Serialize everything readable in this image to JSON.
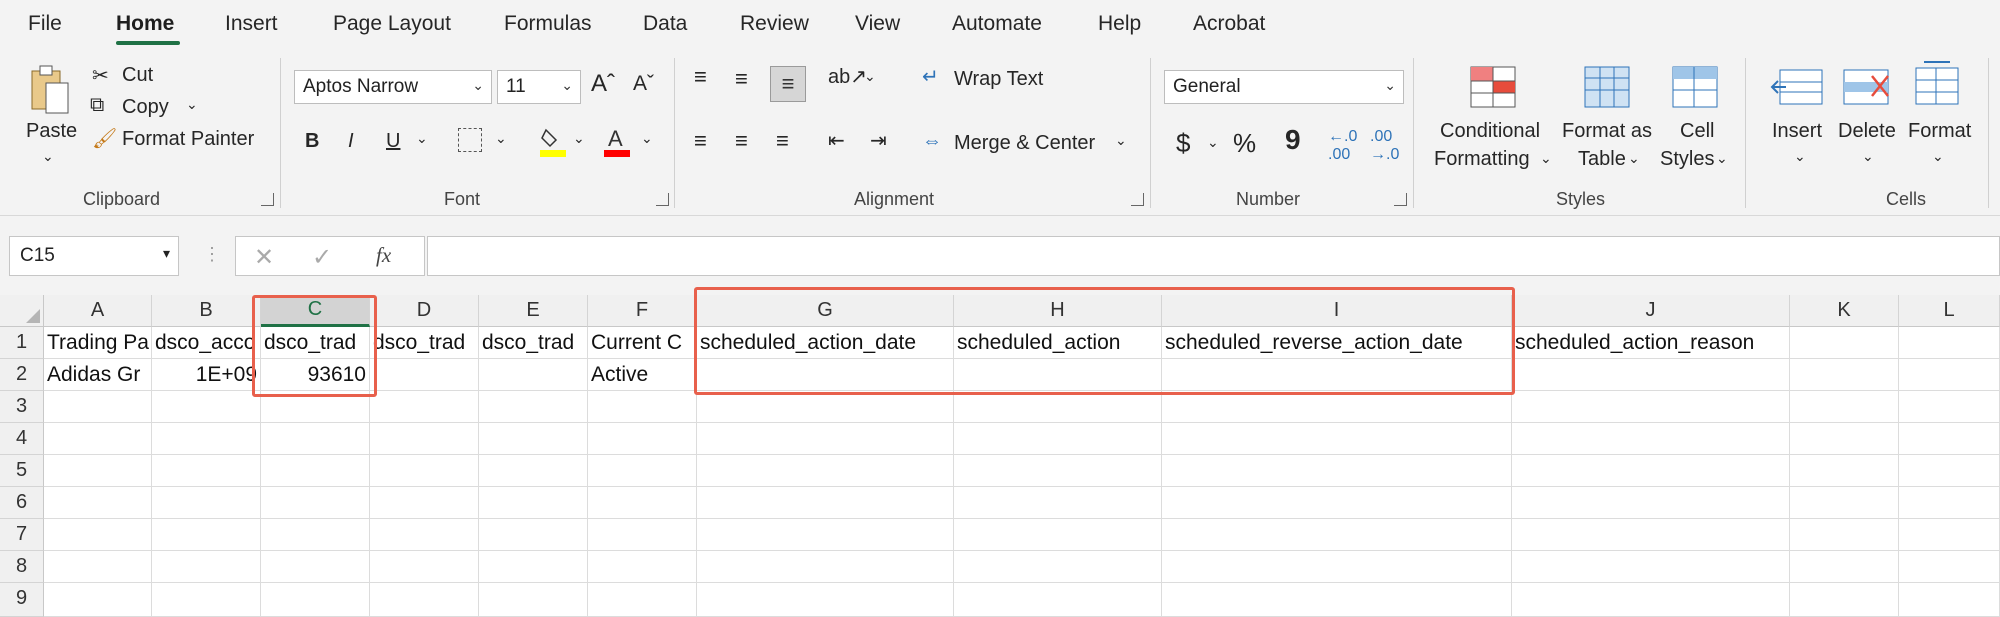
{
  "menu": {
    "items": [
      "File",
      "Home",
      "Insert",
      "Page Layout",
      "Formulas",
      "Data",
      "Review",
      "View",
      "Automate",
      "Help",
      "Acrobat"
    ],
    "active": "Home"
  },
  "ribbon": {
    "clipboard": {
      "paste": "Paste",
      "cut": "Cut",
      "copy": "Copy",
      "format_painter": "Format Painter",
      "label": "Clipboard"
    },
    "font": {
      "name": "Aptos Narrow",
      "size": "11",
      "bold": "B",
      "italic": "I",
      "underline": "U",
      "label": "Font"
    },
    "alignment": {
      "wrap_text": "Wrap Text",
      "merge_center": "Merge & Center",
      "label": "Alignment"
    },
    "number": {
      "format": "General",
      "currency": "$",
      "percent": "%",
      "comma": "9",
      "label": "Number"
    },
    "styles": {
      "conditional_1": "Conditional",
      "conditional_2": "Formatting",
      "format_table_1": "Format as",
      "format_table_2": "Table",
      "cell_styles_1": "Cell",
      "cell_styles_2": "Styles",
      "label": "Styles"
    },
    "cells": {
      "insert": "Insert",
      "delete": "Delete",
      "format": "Format",
      "label": "Cells"
    },
    "colors": {
      "highlight": "#ffff00",
      "font_color": "#ff0000"
    }
  },
  "formula_bar": {
    "name_box": "C15",
    "fx": "fx",
    "value": ""
  },
  "sheet": {
    "columns": [
      "A",
      "B",
      "C",
      "D",
      "E",
      "F",
      "G",
      "H",
      "I",
      "J",
      "K",
      "L"
    ],
    "rows": [
      "1",
      "2",
      "3",
      "4",
      "5",
      "6",
      "7",
      "8",
      "9"
    ],
    "selected_column": "C",
    "row1": [
      "Trading Pa",
      "dsco_acco",
      "dsco_trad",
      "dsco_trad",
      "dsco_trad",
      "Current C",
      "scheduled_action_date",
      "scheduled_action",
      "scheduled_reverse_action_date",
      "scheduled_action_reason",
      "",
      ""
    ],
    "row2": [
      "Adidas Gr",
      "1E+09",
      "93610",
      "",
      "",
      "Active",
      "",
      "",
      "",
      "",
      "",
      ""
    ]
  },
  "annotation_color": "#e8604c"
}
